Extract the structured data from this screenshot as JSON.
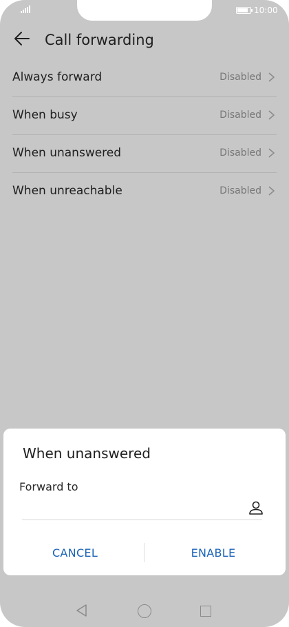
{
  "status_bar": {
    "time": "10:00"
  },
  "header": {
    "title": "Call forwarding"
  },
  "options": [
    {
      "label": "Always forward",
      "status": "Disabled"
    },
    {
      "label": "When busy",
      "status": "Disabled"
    },
    {
      "label": "When unanswered",
      "status": "Disabled"
    },
    {
      "label": "When unreachable",
      "status": "Disabled"
    }
  ],
  "dialog": {
    "title": "When unanswered",
    "field_label": "Forward to",
    "field_value": "",
    "cancel_label": "CANCEL",
    "enable_label": "ENABLE"
  },
  "icons": {
    "back": "arrow-left-icon",
    "chevron": "chevron-right-icon",
    "contact": "person-icon",
    "nav_back": "triangle-back-icon",
    "nav_home": "circle-home-icon",
    "nav_recent": "square-recent-icon"
  },
  "colors": {
    "accent": "#1a63b8",
    "overlay": "#c7c7c7"
  }
}
